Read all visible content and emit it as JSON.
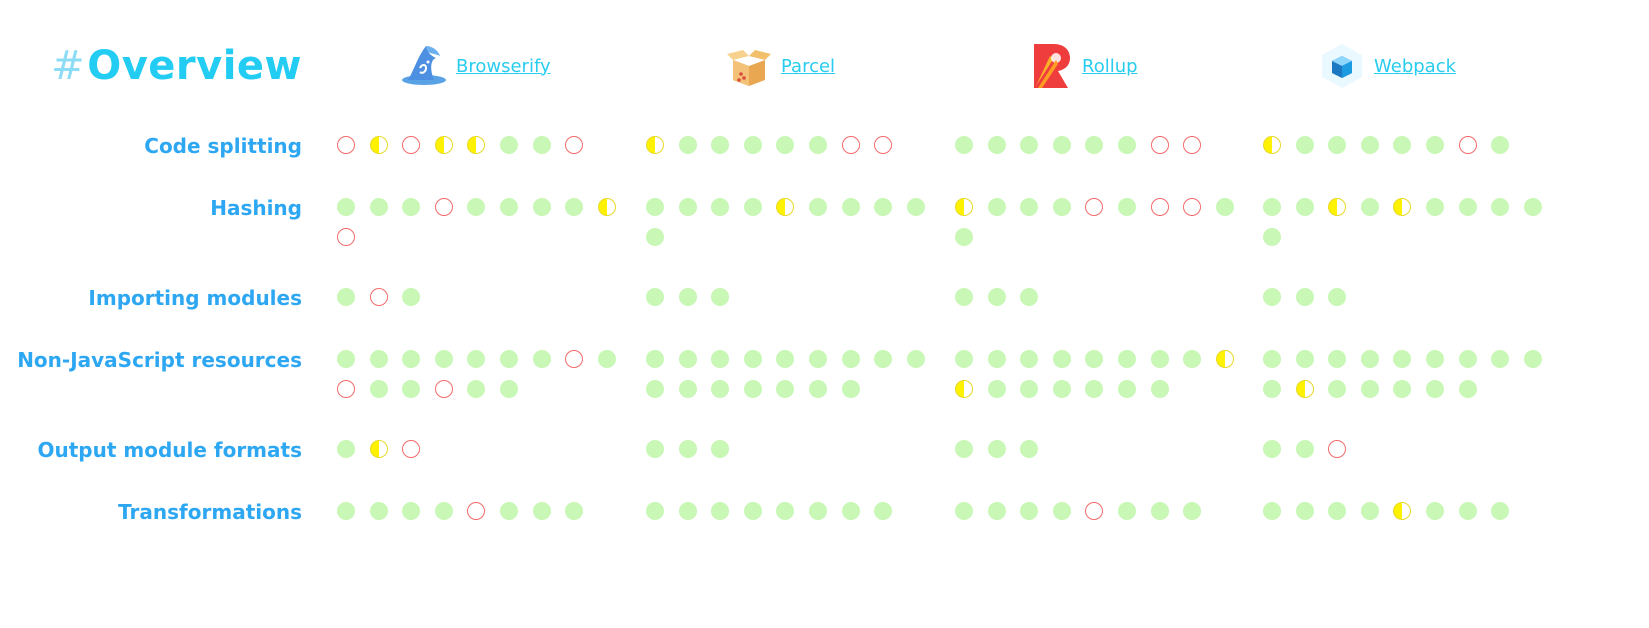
{
  "title": {
    "hash": "#",
    "text": "Overview",
    "color": "#22ccf2"
  },
  "tools": [
    {
      "name": "Browserify",
      "icon": "wizard-hat-icon"
    },
    {
      "name": "Parcel",
      "icon": "box-icon"
    },
    {
      "name": "Rollup",
      "icon": "rollup-icon"
    },
    {
      "name": "Webpack",
      "icon": "cube-icon"
    }
  ],
  "legend_colors": {
    "yes": "#c9f7b6",
    "no": "#f26b6b",
    "partial": "#fff200",
    "label": "#2ea7f2",
    "link": "#27ccef"
  },
  "rows": [
    {
      "label": "Code splitting",
      "cells": [
        [
          "no",
          "partial",
          "no",
          "partial",
          "partial",
          "yes",
          "yes",
          "no"
        ],
        [
          "partial",
          "yes",
          "yes",
          "yes",
          "yes",
          "yes",
          "no",
          "no"
        ],
        [
          "yes",
          "yes",
          "yes",
          "yes",
          "yes",
          "yes",
          "no",
          "no"
        ],
        [
          "partial",
          "yes",
          "yes",
          "yes",
          "yes",
          "yes",
          "no",
          "yes"
        ]
      ]
    },
    {
      "label": "Hashing",
      "cells": [
        [
          "yes",
          "yes",
          "yes",
          "no",
          "yes",
          "yes",
          "yes",
          "yes",
          "partial",
          "no"
        ],
        [
          "yes",
          "yes",
          "yes",
          "yes",
          "partial",
          "yes",
          "yes",
          "yes",
          "yes",
          "yes"
        ],
        [
          "partial",
          "yes",
          "yes",
          "yes",
          "no",
          "yes",
          "no",
          "no",
          "yes",
          "yes"
        ],
        [
          "yes",
          "yes",
          "partial",
          "yes",
          "partial",
          "yes",
          "yes",
          "yes",
          "yes",
          "yes"
        ]
      ]
    },
    {
      "label": "Importing modules",
      "cells": [
        [
          "yes",
          "no",
          "yes"
        ],
        [
          "yes",
          "yes",
          "yes"
        ],
        [
          "yes",
          "yes",
          "yes"
        ],
        [
          "yes",
          "yes",
          "yes"
        ]
      ]
    },
    {
      "label": "Non-JavaScript resources",
      "cells": [
        [
          "yes",
          "yes",
          "yes",
          "yes",
          "yes",
          "yes",
          "yes",
          "no",
          "yes",
          "no",
          "yes",
          "yes",
          "no",
          "yes",
          "yes"
        ],
        [
          "yes",
          "yes",
          "yes",
          "yes",
          "yes",
          "yes",
          "yes",
          "yes",
          "yes",
          "yes",
          "yes",
          "yes",
          "yes",
          "yes",
          "yes",
          "yes"
        ],
        [
          "yes",
          "yes",
          "yes",
          "yes",
          "yes",
          "yes",
          "yes",
          "yes",
          "partial",
          "partial",
          "yes",
          "yes",
          "yes",
          "yes",
          "yes",
          "yes"
        ],
        [
          "yes",
          "yes",
          "yes",
          "yes",
          "yes",
          "yes",
          "yes",
          "yes",
          "yes",
          "yes",
          "partial",
          "yes",
          "yes",
          "yes",
          "yes",
          "yes"
        ]
      ]
    },
    {
      "label": "Output module formats",
      "cells": [
        [
          "yes",
          "partial",
          "no"
        ],
        [
          "yes",
          "yes",
          "yes"
        ],
        [
          "yes",
          "yes",
          "yes"
        ],
        [
          "yes",
          "yes",
          "no"
        ]
      ]
    },
    {
      "label": "Transformations",
      "cells": [
        [
          "yes",
          "yes",
          "yes",
          "yes",
          "no",
          "yes",
          "yes",
          "yes"
        ],
        [
          "yes",
          "yes",
          "yes",
          "yes",
          "yes",
          "yes",
          "yes",
          "yes"
        ],
        [
          "yes",
          "yes",
          "yes",
          "yes",
          "no",
          "yes",
          "yes",
          "yes"
        ],
        [
          "yes",
          "yes",
          "yes",
          "yes",
          "partial",
          "yes",
          "yes",
          "yes"
        ]
      ]
    }
  ]
}
